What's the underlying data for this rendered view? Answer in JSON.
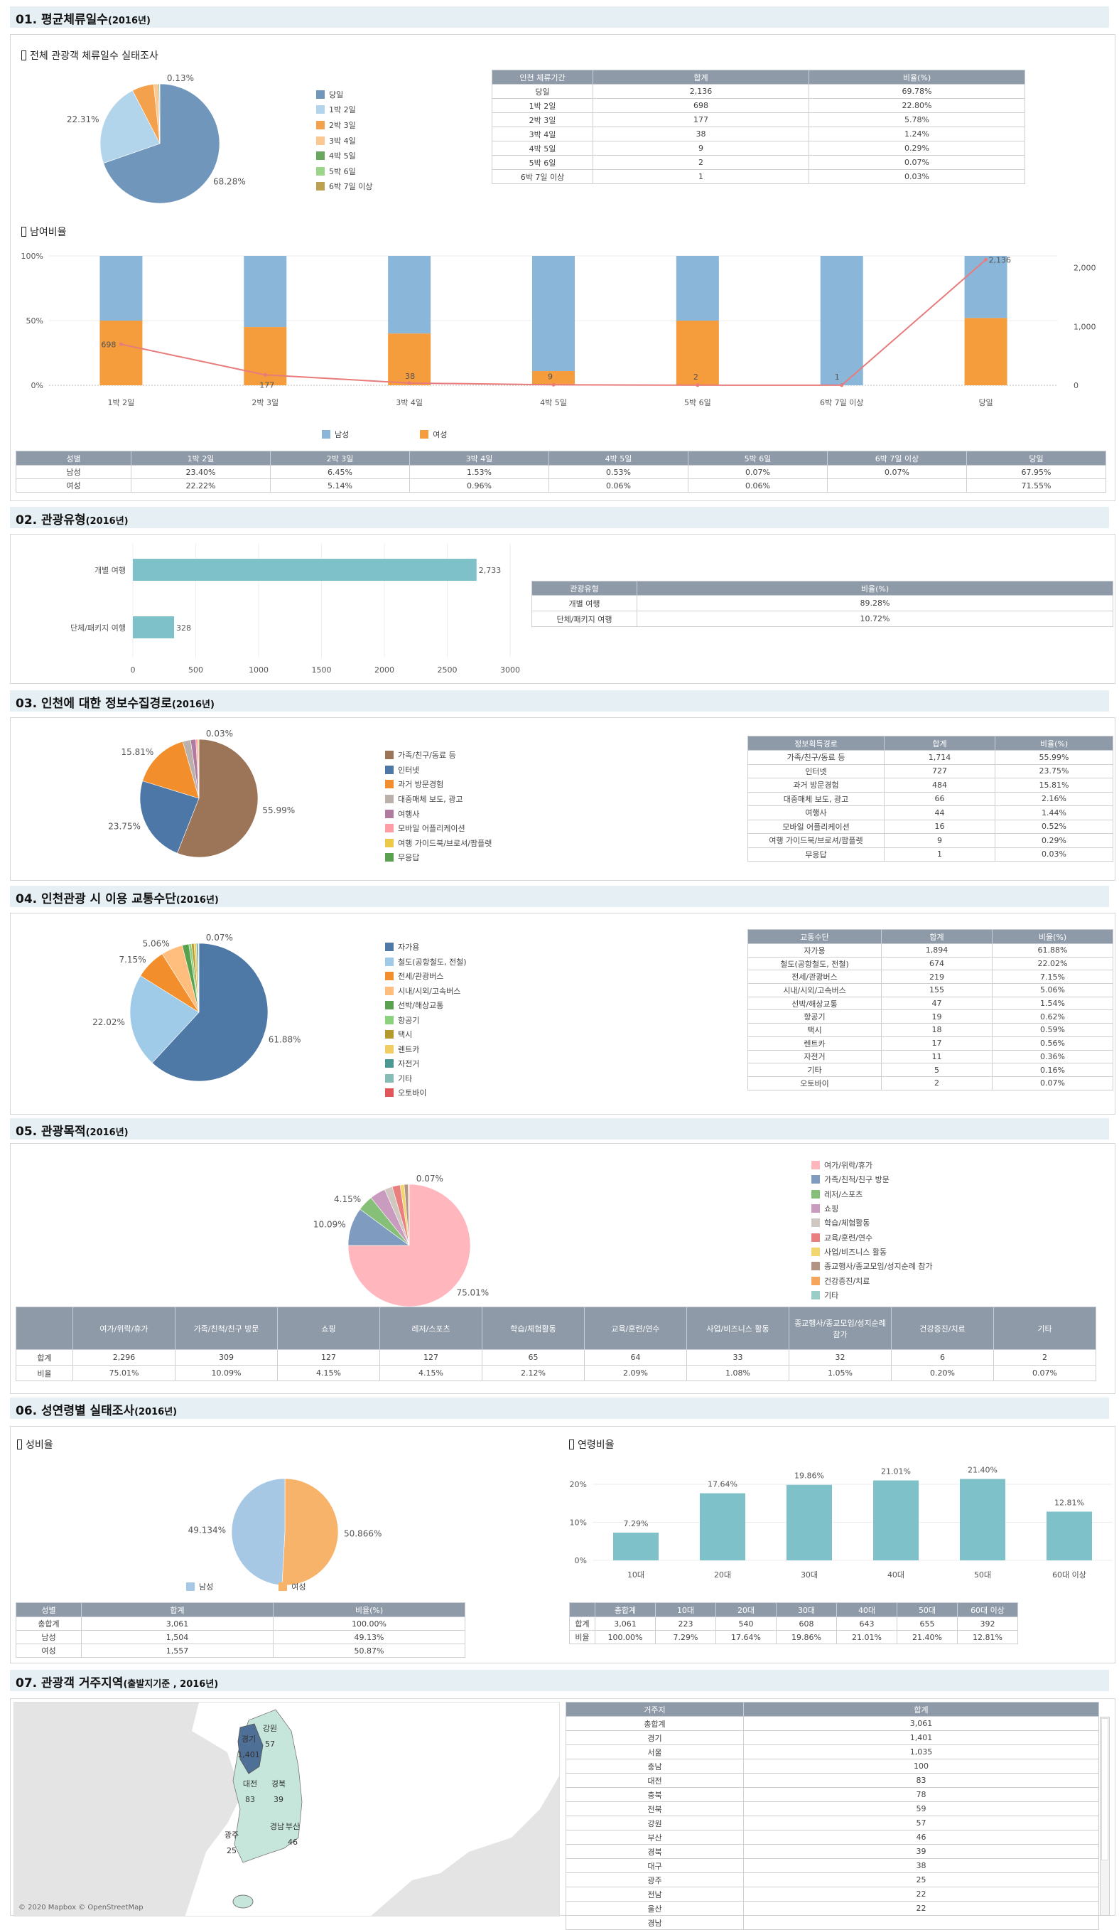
{
  "sections": [
    {
      "title": "01. 평균체류일수",
      "year": "(2016년)"
    },
    {
      "title": "02. 관광유형",
      "year": "(2016년)"
    },
    {
      "title": "03. 인천에 대한 정보수집경로",
      "year": "(2016년)"
    },
    {
      "title": "04. 인천관광 시 이용 교통수단",
      "year": "(2016년)"
    },
    {
      "title": "05. 관광목적",
      "year": "(2016년)"
    },
    {
      "title": "06. 성연령별 실태조사",
      "year": "(2016년)"
    },
    {
      "title": "07. 관광객 거주지역",
      "year": "(출발지기준 , 2016년)"
    }
  ],
  "s1": {
    "subtitle": "전체 관광객 체류일수 실태조사",
    "subtitle2": "남여비율",
    "table": {
      "headers": [
        "인천 체류기간",
        "합계",
        "비율(%)"
      ],
      "rows": [
        [
          "당일",
          "2,136",
          "69.78%"
        ],
        [
          "1박 2일",
          "698",
          "22.80%"
        ],
        [
          "2박 3일",
          "177",
          "5.78%"
        ],
        [
          "3박 4일",
          "38",
          "1.24%"
        ],
        [
          "4박 5일",
          "9",
          "0.29%"
        ],
        [
          "5박 6일",
          "2",
          "0.07%"
        ],
        [
          "6박 7일 이상",
          "1",
          "0.03%"
        ]
      ]
    },
    "gender_table": {
      "headers": [
        "성별",
        "1박 2일",
        "2박 3일",
        "3박 4일",
        "4박 5일",
        "5박 6일",
        "6박 7일 이상",
        "당일"
      ],
      "rows": [
        [
          "남성",
          "23.40%",
          "6.45%",
          "1.53%",
          "0.53%",
          "0.07%",
          "0.07%",
          "67.95%"
        ],
        [
          "여성",
          "22.22%",
          "5.14%",
          "0.96%",
          "0.06%",
          "0.06%",
          "",
          "71.55%"
        ]
      ]
    }
  },
  "s2": {
    "table": {
      "headers": [
        "관광유형",
        "비율(%)"
      ],
      "rows": [
        [
          "개별 여행",
          "89.28%"
        ],
        [
          "단체/패키지 여행",
          "10.72%"
        ]
      ]
    }
  },
  "s3": {
    "table": {
      "headers": [
        "정보획득경로",
        "합계",
        "비율(%)"
      ],
      "rows": [
        [
          "가족/친구/동료 등",
          "1,714",
          "55.99%"
        ],
        [
          "인터넷",
          "727",
          "23.75%"
        ],
        [
          "과거 방문경험",
          "484",
          "15.81%"
        ],
        [
          "대중매체 보도, 광고",
          "66",
          "2.16%"
        ],
        [
          "여행사",
          "44",
          "1.44%"
        ],
        [
          "모바일 어플리케이션",
          "16",
          "0.52%"
        ],
        [
          "여행 가이드북/브로셔/팜플렛",
          "9",
          "0.29%"
        ],
        [
          "무응답",
          "1",
          "0.03%"
        ]
      ]
    }
  },
  "s4": {
    "table": {
      "headers": [
        "교통수단",
        "합계",
        "비율(%)"
      ],
      "rows": [
        [
          "자가용",
          "1,894",
          "61.88%"
        ],
        [
          "철도(공항철도, 전철)",
          "674",
          "22.02%"
        ],
        [
          "전세/관광버스",
          "219",
          "7.15%"
        ],
        [
          "시내/시외/고속버스",
          "155",
          "5.06%"
        ],
        [
          "선박/해상교통",
          "47",
          "1.54%"
        ],
        [
          "항공기",
          "19",
          "0.62%"
        ],
        [
          "택시",
          "18",
          "0.59%"
        ],
        [
          "렌트카",
          "17",
          "0.56%"
        ],
        [
          "자전거",
          "11",
          "0.36%"
        ],
        [
          "기타",
          "5",
          "0.16%"
        ],
        [
          "오토바이",
          "2",
          "0.07%"
        ]
      ]
    }
  },
  "s5": {
    "table": {
      "headers": [
        "",
        "여가/위락/휴가",
        "가족/친척/친구 방문",
        "쇼핑",
        "레저/스포츠",
        "학습/체험활동",
        "교육/훈련/연수",
        "사업/비즈니스 활동",
        "종교행사/종교모임/성지순례 참가",
        "건강증진/치료",
        "기타"
      ],
      "rows": [
        [
          "합계",
          "2,296",
          "309",
          "127",
          "127",
          "65",
          "64",
          "33",
          "32",
          "6",
          "2"
        ],
        [
          "비율",
          "75.01%",
          "10.09%",
          "4.15%",
          "4.15%",
          "2.12%",
          "2.09%",
          "1.08%",
          "1.05%",
          "0.20%",
          "0.07%"
        ]
      ]
    }
  },
  "s6": {
    "subtitle": "성비율",
    "subtitle2": "연령비율",
    "gender_table": {
      "headers": [
        "성별",
        "합계",
        "비율(%)"
      ],
      "rows": [
        [
          "총합계",
          "3,061",
          "100.00%"
        ],
        [
          "남성",
          "1,504",
          "49.13%"
        ],
        [
          "여성",
          "1,557",
          "50.87%"
        ]
      ]
    },
    "age_table": {
      "headers": [
        "",
        "총합계",
        "10대",
        "20대",
        "30대",
        "40대",
        "50대",
        "60대 이상"
      ],
      "rows": [
        [
          "합계",
          "3,061",
          "223",
          "540",
          "608",
          "643",
          "655",
          "392"
        ],
        [
          "비율",
          "100.00%",
          "7.29%",
          "17.64%",
          "19.86%",
          "21.01%",
          "21.40%",
          "12.81%"
        ]
      ]
    }
  },
  "s7": {
    "map_credit": "© 2020 Mapbox © OpenStreetMap",
    "map_labels": [
      {
        "region": "강원",
        "value": "57"
      },
      {
        "region": "경기",
        "value": "1,401"
      },
      {
        "region": "대전",
        "value": "83"
      },
      {
        "region": "경북",
        "value": "39"
      },
      {
        "region": "경남",
        "value": ""
      },
      {
        "region": "부산",
        "value": "46"
      },
      {
        "region": "광주",
        "value": "25"
      }
    ],
    "colors": {
      "highlight": "#4e6f96",
      "region": "#c6e6dc",
      "land": "#e4e4e4"
    },
    "table": {
      "headers": [
        "거주지",
        "합계"
      ],
      "rows": [
        [
          "총합계",
          "3,061"
        ],
        [
          "경기",
          "1,401"
        ],
        [
          "서울",
          "1,035"
        ],
        [
          "충남",
          "100"
        ],
        [
          "대전",
          "83"
        ],
        [
          "충북",
          "78"
        ],
        [
          "전북",
          "59"
        ],
        [
          "강원",
          "57"
        ],
        [
          "부산",
          "46"
        ],
        [
          "경북",
          "39"
        ],
        [
          "대구",
          "38"
        ],
        [
          "광주",
          "25"
        ],
        [
          "전남",
          "22"
        ],
        [
          "울산",
          "22"
        ],
        [
          "경남",
          ""
        ]
      ]
    }
  },
  "chart_data": [
    {
      "id": "stay_pie",
      "type": "pie",
      "categories": [
        "당일",
        "1박 2일",
        "2박 3일",
        "3박 4일",
        "4박 5일",
        "5박 6일",
        "6박 7일 이상"
      ],
      "values": [
        68.28,
        22.31,
        5.78,
        1.24,
        0.29,
        0.07,
        0.03
      ],
      "data_labels": [
        "68.28%",
        "22.31%",
        "",
        "",
        "",
        "",
        "0.13%"
      ],
      "colors": [
        "#7096bb",
        "#b3d5ec",
        "#f4a14d",
        "#fbc893",
        "#69a75e",
        "#9ad58a",
        "#bca150"
      ],
      "legend": "right"
    },
    {
      "id": "gender_stack",
      "type": "bar",
      "stacked": "100%",
      "categories": [
        "1박 2일",
        "2박 3일",
        "3박 4일",
        "4박 5일",
        "5박 6일",
        "6박 7일 이상",
        "당일"
      ],
      "series": [
        {
          "name": "남성",
          "values": [
            50,
            55,
            60,
            89,
            50,
            100,
            48
          ],
          "color": "#8ab6d9"
        },
        {
          "name": "여성",
          "values": [
            50,
            45,
            40,
            11,
            50,
            0,
            52
          ],
          "color": "#f59c3c"
        }
      ],
      "line": {
        "values": [
          698,
          177,
          38,
          9,
          2,
          1,
          2136
        ],
        "labels": [
          "698",
          "177",
          "38",
          "9",
          "2",
          "1",
          "2,136"
        ],
        "color": "#e87b7b"
      },
      "yticks_left": [
        "0%",
        "50%",
        "100%"
      ],
      "yticks_right": [
        "0",
        "1,000",
        "2,000"
      ],
      "ylim_right": [
        0,
        2200
      ],
      "legend": "bottom"
    },
    {
      "id": "type_bar",
      "type": "bar",
      "orientation": "horizontal",
      "categories": [
        "개별 여행",
        "단체/패키지 여행"
      ],
      "values": [
        2733,
        328
      ],
      "value_labels": [
        "2,733",
        "328"
      ],
      "xlim": [
        0,
        3000
      ],
      "xticks": [
        "0",
        "500",
        "1000",
        "1500",
        "2000",
        "2500",
        "3000"
      ],
      "color": "#7fc1c9"
    },
    {
      "id": "info_pie",
      "type": "pie",
      "categories": [
        "가족/친구/동료 등",
        "인터넷",
        "과거 방문경험",
        "대중매체 보도, 광고",
        "여행사",
        "모바일 어플리케이션",
        "여행 가이드북/브로셔/팜플렛",
        "무응답"
      ],
      "values": [
        55.99,
        23.75,
        15.81,
        2.16,
        1.44,
        0.52,
        0.29,
        0.03
      ],
      "data_labels": [
        "55.99%",
        "23.75%",
        "15.81%",
        "",
        "",
        "",
        "",
        "0.03%"
      ],
      "colors": [
        "#9c7559",
        "#4c77a6",
        "#f28e2b",
        "#bab0ac",
        "#b07aa1",
        "#ff9da7",
        "#edc948",
        "#59a14f"
      ],
      "legend": "right"
    },
    {
      "id": "transport_pie",
      "type": "pie",
      "categories": [
        "자가용",
        "철도(공항철도, 전철)",
        "전세/관광버스",
        "시내/시외/고속버스",
        "선박/해상교통",
        "항공기",
        "택시",
        "렌트카",
        "자전거",
        "기타",
        "오토바이"
      ],
      "values": [
        61.88,
        22.02,
        7.15,
        5.06,
        1.54,
        0.62,
        0.59,
        0.56,
        0.36,
        0.16,
        0.07
      ],
      "data_labels": [
        "61.88%",
        "22.02%",
        "7.15%",
        "5.06%",
        "",
        "",
        "",
        "",
        "",
        "",
        "0.07%"
      ],
      "colors": [
        "#4e79a7",
        "#a0cbe8",
        "#f28e2b",
        "#ffbe7d",
        "#59a14f",
        "#8cd17d",
        "#b6992d",
        "#f1ce63",
        "#499894",
        "#86bcb6",
        "#e15759"
      ],
      "legend": "right"
    },
    {
      "id": "purpose_pie",
      "type": "pie",
      "categories": [
        "여가/위락/휴가",
        "가족/친척/친구 방문",
        "레저/스포츠",
        "쇼핑",
        "학습/체험활동",
        "교육/훈련/연수",
        "사업/비즈니스 활동",
        "종교행사/종교모임/성지순례 참가",
        "건강증진/치료",
        "기타"
      ],
      "values": [
        75.01,
        10.09,
        4.15,
        4.15,
        2.12,
        2.09,
        1.08,
        1.05,
        0.2,
        0.07
      ],
      "data_labels": [
        "75.01%",
        "10.09%",
        "4.15%",
        "",
        "",
        "",
        "",
        "",
        "",
        "0.07%"
      ],
      "colors": [
        "#ffb6bd",
        "#7f9cc0",
        "#86bf77",
        "#c99bbf",
        "#d1c7c1",
        "#ea7f80",
        "#f2d56e",
        "#b39484",
        "#f5a55c",
        "#9bcdc7"
      ],
      "legend": "right"
    },
    {
      "id": "sex_pie",
      "type": "pie",
      "categories": [
        "남성",
        "여성"
      ],
      "values": [
        49.134,
        50.866
      ],
      "data_labels": [
        "49.134%",
        "50.866%"
      ],
      "colors": [
        "#a6c8e4",
        "#f8b36a"
      ],
      "legend": "bottom"
    },
    {
      "id": "age_bar",
      "type": "bar",
      "categories": [
        "10대",
        "20대",
        "30대",
        "40대",
        "50대",
        "60대 이상"
      ],
      "values": [
        7.29,
        17.64,
        19.86,
        21.01,
        21.4,
        12.81
      ],
      "value_labels": [
        "7.29%",
        "17.64%",
        "19.86%",
        "21.01%",
        "21.40%",
        "12.81%"
      ],
      "yticks": [
        "0%",
        "10%",
        "20%"
      ],
      "ylim": [
        0,
        25.5
      ],
      "color": "#7fc1c9"
    }
  ]
}
